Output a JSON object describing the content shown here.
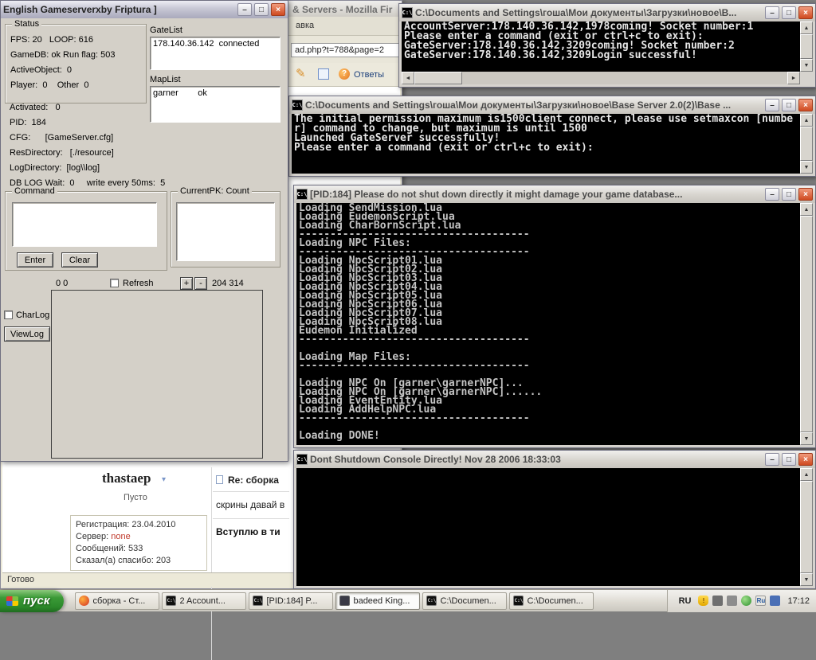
{
  "gameserver": {
    "title": "English Gameserverxby Friptura ]",
    "minimize": "–",
    "maximize": "□",
    "close": "×",
    "status_label": "Status",
    "status_lines": [
      "FPS: 20   LOOP: 616",
      "GameDB: ok Run flag: 503",
      "ActiveObject:  0",
      "Player:  0    Other  0"
    ],
    "info_lines": [
      "Activated:   0",
      "PID:  184",
      "CFG:      [GameServer.cfg]",
      "ResDirectory:   [./resource]",
      "LogDirectory:  [log\\\\log]",
      "DB LOG Wait:  0     write every 50ms:  5"
    ],
    "gatelist_label": "GateList",
    "gatelist_item": "178.140.36.142  connected",
    "maplist_label": "MapList",
    "maplist_item": "garner        ok",
    "command_label": "Command",
    "enter_button": "Enter",
    "clear_button": "Clear",
    "currentpk_label": "CurrentPK:  Count",
    "pair_left": "0 0",
    "refresh_label": "Refresh",
    "plus_button": "+",
    "minus_button": "-",
    "pair_right": "204 314",
    "charlog_label": "CharLog",
    "viewlog_button": "ViewLog"
  },
  "firefox": {
    "title": "& Servers - Mozilla Fir",
    "tab_text": "авка",
    "url": "ad.php?t=788&page=2",
    "answers_label": "Ответы",
    "forum": {
      "username": "thastaep",
      "user_status": "Пусто",
      "reg_line": "Регистрация: 23.04.2010",
      "server_label": "Сервер:",
      "server_value": "none",
      "messages_line": "Сообщений: 533",
      "thanks_line": "Сказал(а) спасибо: 203",
      "post_title": "Re: сборка",
      "post_line1": "скрины давай в",
      "post_line2": "Вступлю в ти"
    },
    "statusbar": "Готово"
  },
  "console1": {
    "title": "C:\\Documents and Settings\\гоша\\Мои документы\\Загрузки\\новое\\B...",
    "lines": [
      "AccountServer:178.140.36.142,1978coming! Socket number:1",
      "Please enter a command (exit or ctrl+c to exit):",
      "GateServer:178.140.36.142,3209coming! Socket number:2",
      "GateServer:178.140.36.142,3209Login successful!"
    ]
  },
  "console2": {
    "title": "C:\\Documents and Settings\\гоша\\Мои документы\\Загрузки\\новое\\Base Server 2.0(2)\\Base ...",
    "lines": [
      "The initial permission maximum is1500client connect, please use setmaxcon [numbe",
      "r] command to change, but maximum is until 1500",
      "Launched GateServer successfully!",
      "Please enter a command (exit or ctrl+c to exit):"
    ]
  },
  "console3": {
    "title": "[PID:184]  Please do not shut down directly it might damage your game database...",
    "lines": [
      "Loading SendMission.lua",
      "Loading EudemonScript.lua",
      "Loading CharBornScript.lua",
      "-------------------------------------",
      "Loading NPC Files:",
      "-------------------------------------",
      "Loading NpcScript01.lua",
      "Loading NpcScript02.lua",
      "Loading NpcScript03.lua",
      "Loading NpcScript04.lua",
      "Loading NpcScript05.lua",
      "Loading NpcScript06.lua",
      "Loading NpcScript07.lua",
      "Loading NpcScript08.lua",
      "Eudemon Initialized",
      "-------------------------------------",
      "",
      "Loading Map Files:",
      "-------------------------------------",
      "",
      "Loading NPC On [garner\\garnerNPC]...",
      "Loading NPC On [garner\\garnerNPC]......",
      "loading EventEntity.lua",
      "Loading AddHelpNPC.lua",
      "-------------------------------------",
      "",
      "Loading DONE!"
    ]
  },
  "console4": {
    "title": "Dont Shutdown Console Directly! Nov 28 2006 18:33:03",
    "lines": []
  },
  "taskbar": {
    "start": "пуск",
    "tasks": [
      {
        "label": "сборка - Ст..."
      },
      {
        "label": "2 Account..."
      },
      {
        "label": "[PID:184] P..."
      },
      {
        "label": "badeed King..."
      },
      {
        "label": "C:\\Documen..."
      },
      {
        "label": "C:\\Documen..."
      }
    ],
    "lang": "RU",
    "clock": "17:12"
  }
}
